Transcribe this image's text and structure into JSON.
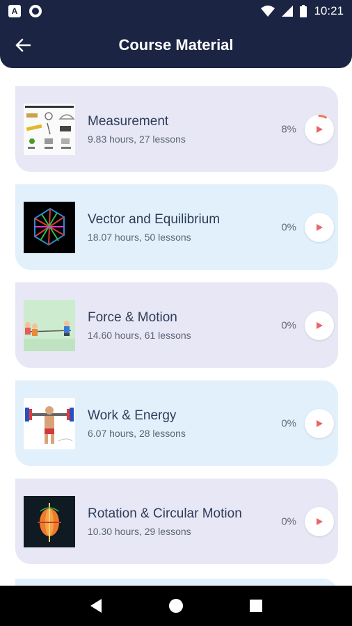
{
  "status_bar": {
    "time": "10:21",
    "left_icons": [
      "app-icon",
      "record-icon"
    ],
    "right_icons": [
      "wifi-icon",
      "signal-icon",
      "battery-icon"
    ]
  },
  "app_bar": {
    "title": "Course Material",
    "back_icon": "arrow-left-icon"
  },
  "courses": [
    {
      "title": "Measurement",
      "meta": "9.83 hours, 27 lessons",
      "progress": "8%",
      "progress_value": 0.08,
      "bg": "purple"
    },
    {
      "title": "Vector and Equilibrium",
      "meta": "18.07 hours, 50 lessons",
      "progress": "0%",
      "progress_value": 0,
      "bg": "blue"
    },
    {
      "title": "Force & Motion",
      "meta": "14.60 hours, 61 lessons",
      "progress": "0%",
      "progress_value": 0,
      "bg": "purple"
    },
    {
      "title": "Work & Energy",
      "meta": "6.07 hours, 28 lessons",
      "progress": "0%",
      "progress_value": 0,
      "bg": "blue"
    },
    {
      "title": "Rotation & Circular Motion",
      "meta": "10.30 hours, 29 lessons",
      "progress": "0%",
      "progress_value": 0,
      "bg": "purple"
    }
  ],
  "colors": {
    "header": "#1b2443",
    "card_purple": "#e7e7f6",
    "card_blue": "#e1f0fb",
    "play_icon": "#e8666a",
    "progress_arc": "#f07a4a"
  },
  "nav_bar": {
    "icons": [
      "back-triangle-icon",
      "home-circle-icon",
      "recents-square-icon"
    ]
  }
}
